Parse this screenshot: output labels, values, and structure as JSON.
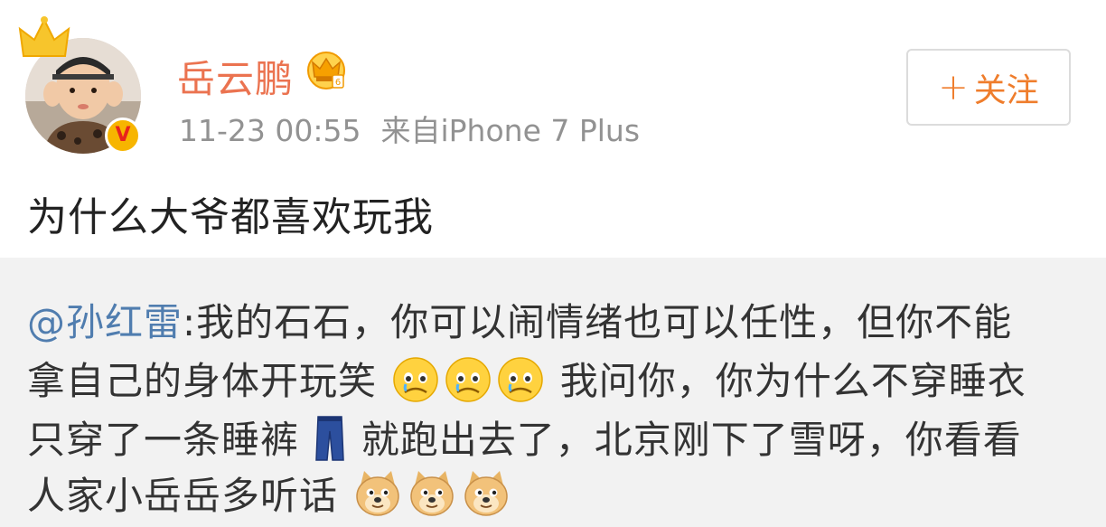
{
  "post": {
    "username": "岳云鹏",
    "timestamp": "11-23 00:55",
    "source": "来自iPhone 7 Plus",
    "follow_label": "关注",
    "follow_plus": "+",
    "text": "为什么大爷都喜欢玩我",
    "verified_badge": "V",
    "colors": {
      "username": "#eb7350",
      "follow": "#ef7d2c",
      "meta": "#929292"
    }
  },
  "repost": {
    "mention": "@孙红雷",
    "line1_text": ":我的石石，你可以闹情绪也可以任性，但你不能",
    "line2_text_a": "拿自己的身体开玩笑",
    "line2_text_b": "我问你，你为什么不穿睡衣",
    "line3_text_a": "只穿了一条睡裤",
    "line3_text_b": "就跑出去了，北京刚下了雪呀，你看看",
    "line4_text": "人家小岳岳多听话",
    "mention_color": "#507daf",
    "background": "#f2f2f2"
  },
  "icons": {
    "crown": "crown-icon",
    "vip": "vip-crown-icon",
    "sad_emoji": "sad-face-emoji-icon",
    "pants_emoji": "jeans-icon",
    "doge_emoji": "doge-emoji-icon"
  }
}
